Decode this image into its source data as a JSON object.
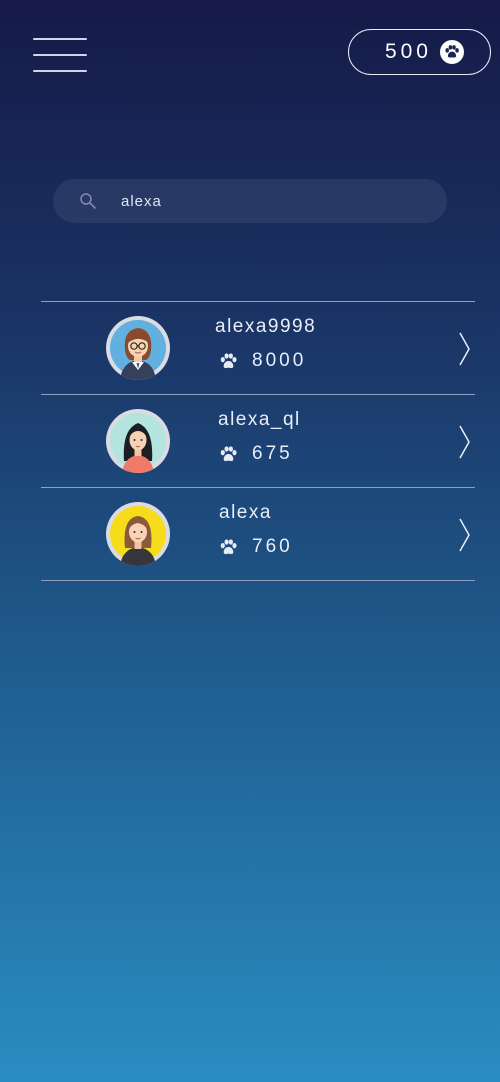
{
  "header": {
    "balance": "500",
    "balance_icon": "paw-icon"
  },
  "search": {
    "value": "alexa",
    "icon": "search-icon"
  },
  "results": [
    {
      "username": "alexa9998",
      "score": "8000",
      "avatar": "avatar-woman-glasses"
    },
    {
      "username": "alexa_ql",
      "score": "675",
      "avatar": "avatar-woman-dark-hair"
    },
    {
      "username": "alexa",
      "score": "760",
      "avatar": "avatar-woman-brown-hair"
    }
  ],
  "colors": {
    "background_top": "#161a48",
    "background_bottom": "#2a8dc2",
    "text": "#ffffff"
  }
}
